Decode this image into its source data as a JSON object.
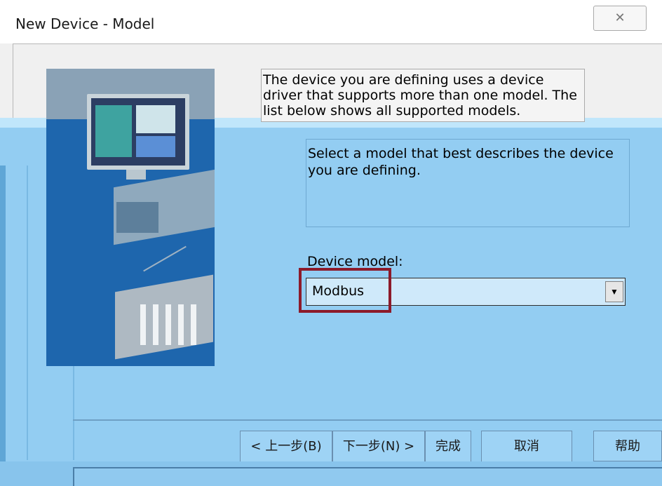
{
  "window": {
    "title": "New Device - Model",
    "close_glyph": "✕"
  },
  "description": {
    "intro": "The device you are defining uses a device driver that supports more than one model. The list below shows all supported models.",
    "instruction": "Select a model that best describes the device you are defining."
  },
  "device_model": {
    "label": "Device model:",
    "value": "Modbus",
    "dropdown_icon": "chevron-down-icon"
  },
  "buttons": {
    "back": "< 上一步(B)",
    "next": "下一步(N) >",
    "finish": "完成",
    "cancel": "取消",
    "help": "帮助"
  },
  "colors": {
    "highlight": "#8c1a2a",
    "tint": "#93cdf2"
  }
}
